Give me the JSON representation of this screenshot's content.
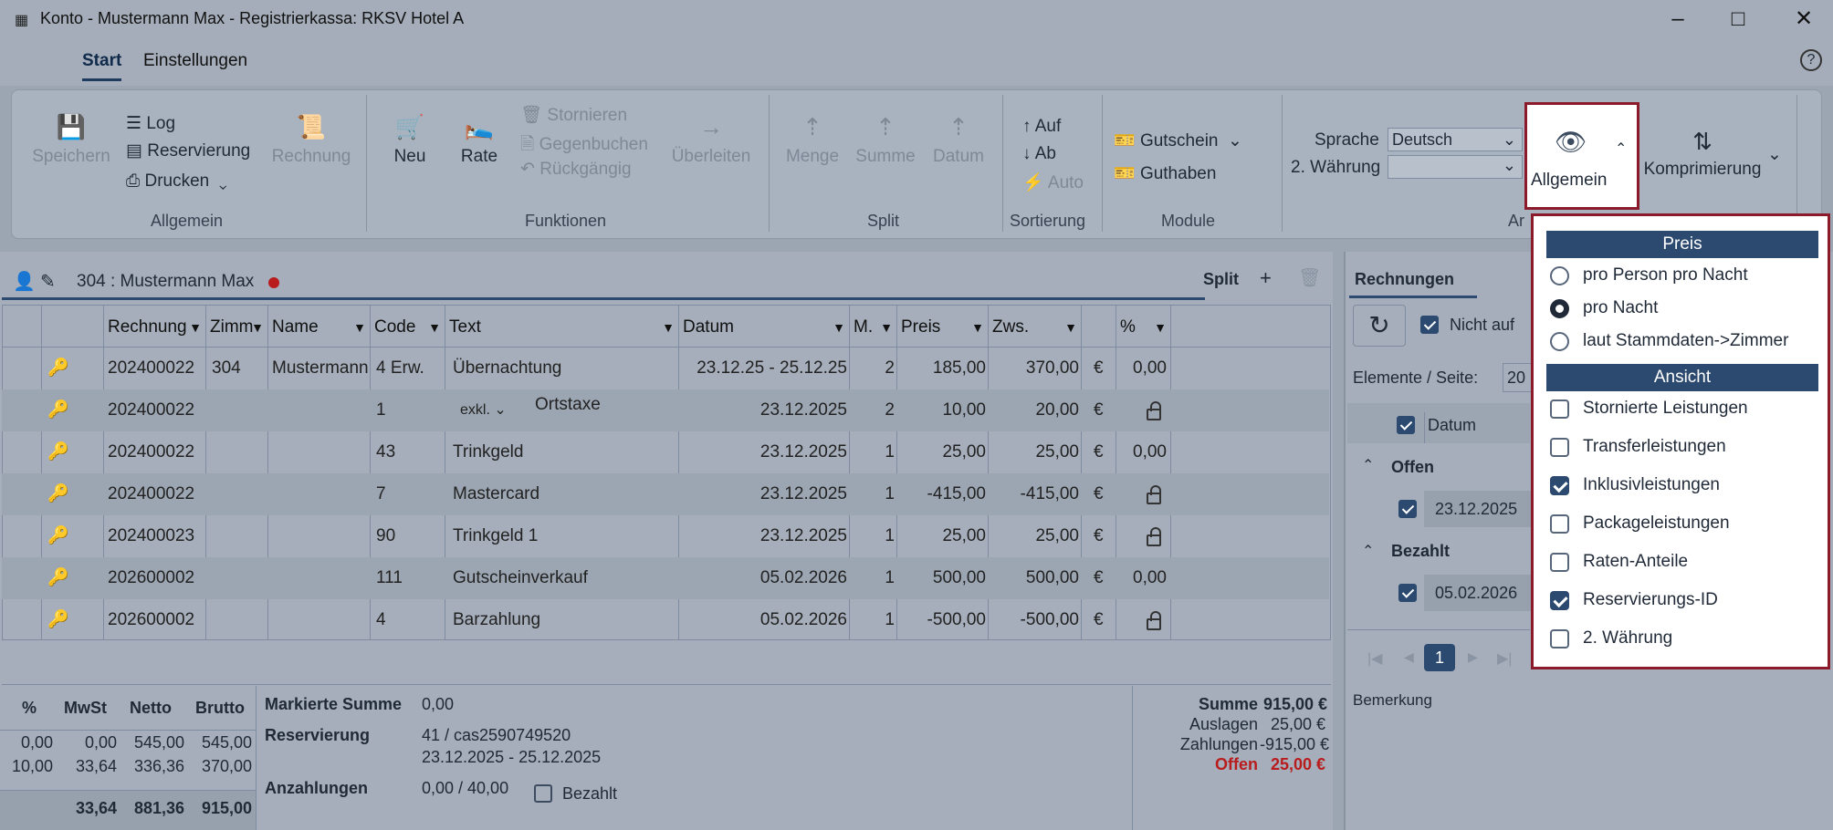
{
  "window": {
    "title": "Konto - Mustermann Max - Registrierkassa: RKSV Hotel A"
  },
  "tabs": [
    "Start",
    "Einstellungen"
  ],
  "ribbon": {
    "allgemein": {
      "speichern": "Speichern",
      "log": "Log",
      "reservierung": "Reservierung",
      "drucken": "Drucken",
      "rechnung": "Rechnung",
      "group": "Allgemein"
    },
    "funktionen": {
      "neu": "Neu",
      "rate": "Rate",
      "stornieren": "Stornieren",
      "gegenbuchen": "Gegenbuchen",
      "rueckgaengig": "Rückgängig",
      "ueberleiten": "Überleiten",
      "group": "Funktionen"
    },
    "split": {
      "menge": "Menge",
      "summe": "Summe",
      "datum": "Datum",
      "group": "Split"
    },
    "sortierung": {
      "auf": "Auf",
      "ab": "Ab",
      "auto": "Auto",
      "group": "Sortierung"
    },
    "module": {
      "gutschein": "Gutschein",
      "guthaben": "Guthaben",
      "group": "Module"
    },
    "ansicht": {
      "sprache_label": "Sprache",
      "sprache_value": "Deutsch",
      "waehrung_label": "2. Währung",
      "allgemein": "Allgemein",
      "komprimierung": "Komprimierung",
      "group": "Ar"
    }
  },
  "account": {
    "label": "304 :  Mustermann Max",
    "split": "Split"
  },
  "table": {
    "headers": [
      "Rechnung",
      "Zimm",
      "Name",
      "Code",
      "Text",
      "Datum",
      "M.",
      "Preis",
      "Zws.",
      "",
      "%"
    ],
    "rows": [
      [
        "202400022",
        "304",
        "Mustermann",
        "4 Erw.",
        "Übernachtung",
        "23.12.25 - 25.12.25",
        "2",
        "185,00",
        "370,00",
        "€",
        "0,00"
      ],
      [
        "202400022",
        "",
        "",
        "1",
        "Ortstaxe",
        "23.12.2025",
        "2",
        "10,00",
        "20,00",
        "€",
        ""
      ],
      [
        "202400022",
        "",
        "",
        "43",
        "Trinkgeld",
        "23.12.2025",
        "1",
        "25,00",
        "25,00",
        "€",
        "0,00"
      ],
      [
        "202400022",
        "",
        "",
        "7",
        "Mastercard",
        "23.12.2025",
        "1",
        "-415,00",
        "-415,00",
        "€",
        ""
      ],
      [
        "202400023",
        "",
        "",
        "90",
        "Trinkgeld 1",
        "23.12.2025",
        "1",
        "25,00",
        "25,00",
        "€",
        ""
      ],
      [
        "202600002",
        "",
        "",
        "111",
        "Gutscheinverkauf",
        "05.02.2026",
        "1",
        "500,00",
        "500,00",
        "€",
        "0,00"
      ],
      [
        "202600002",
        "",
        "",
        "4",
        "Barzahlung",
        "05.02.2026",
        "1",
        "-500,00",
        "-500,00",
        "€",
        ""
      ]
    ],
    "exkl": "exkl."
  },
  "vat": {
    "headers": [
      "%",
      "MwSt",
      "Netto",
      "Brutto"
    ],
    "rows": [
      [
        "0,00",
        "0,00",
        "545,00",
        "545,00"
      ],
      [
        "10,00",
        "33,64",
        "336,36",
        "370,00"
      ]
    ],
    "total": [
      "33,64",
      "881,36",
      "915,00"
    ]
  },
  "info": {
    "markierte_label": "Markierte Summe",
    "markierte_value": "0,00",
    "reservierung_label": "Reservierung",
    "reservierung_value": "41 / cas2590749520",
    "reservierung_dates": "23.12.2025  -  25.12.2025",
    "anzahlungen_label": "Anzahlungen",
    "anzahlungen_value": "0,00 / 40,00",
    "bezahlt": "Bezahlt"
  },
  "totals": {
    "summe_label": "Summe",
    "summe_value": "915,00 €",
    "auslagen_label": "Auslagen",
    "auslagen_value": "25,00 €",
    "zahlungen_label": "Zahlungen",
    "zahlungen_value": "-915,00 €",
    "offen_label": "Offen",
    "offen_value": "25,00 €"
  },
  "rechnungen": {
    "tab": "Rechnungen",
    "nicht_auf": "Nicht auf",
    "elemente": "Elemente / Seite:",
    "elemente_value": "20",
    "datum": "Datum",
    "offen": "Offen",
    "bezahlt": "Bezahlt",
    "row1": "23.12.2025",
    "row2": "05.02.2026",
    "page": "1",
    "bemerkung": "Bemerkung"
  },
  "popup": {
    "preis": "Preis",
    "preis_options": [
      "pro Person pro Nacht",
      "pro Nacht",
      "laut Stammdaten->Zimmer"
    ],
    "ansicht": "Ansicht",
    "ansicht_options": [
      "Stornierte Leistungen",
      "Transferleistungen",
      "Inklusivleistungen",
      "Packageleistungen",
      "Raten-Anteile",
      "Reservierungs-ID",
      "2. Währung"
    ]
  },
  "colors": {
    "accent": "#2c4a70",
    "highlight_border": "#8b1a2b",
    "offen": "#b91c1c"
  }
}
